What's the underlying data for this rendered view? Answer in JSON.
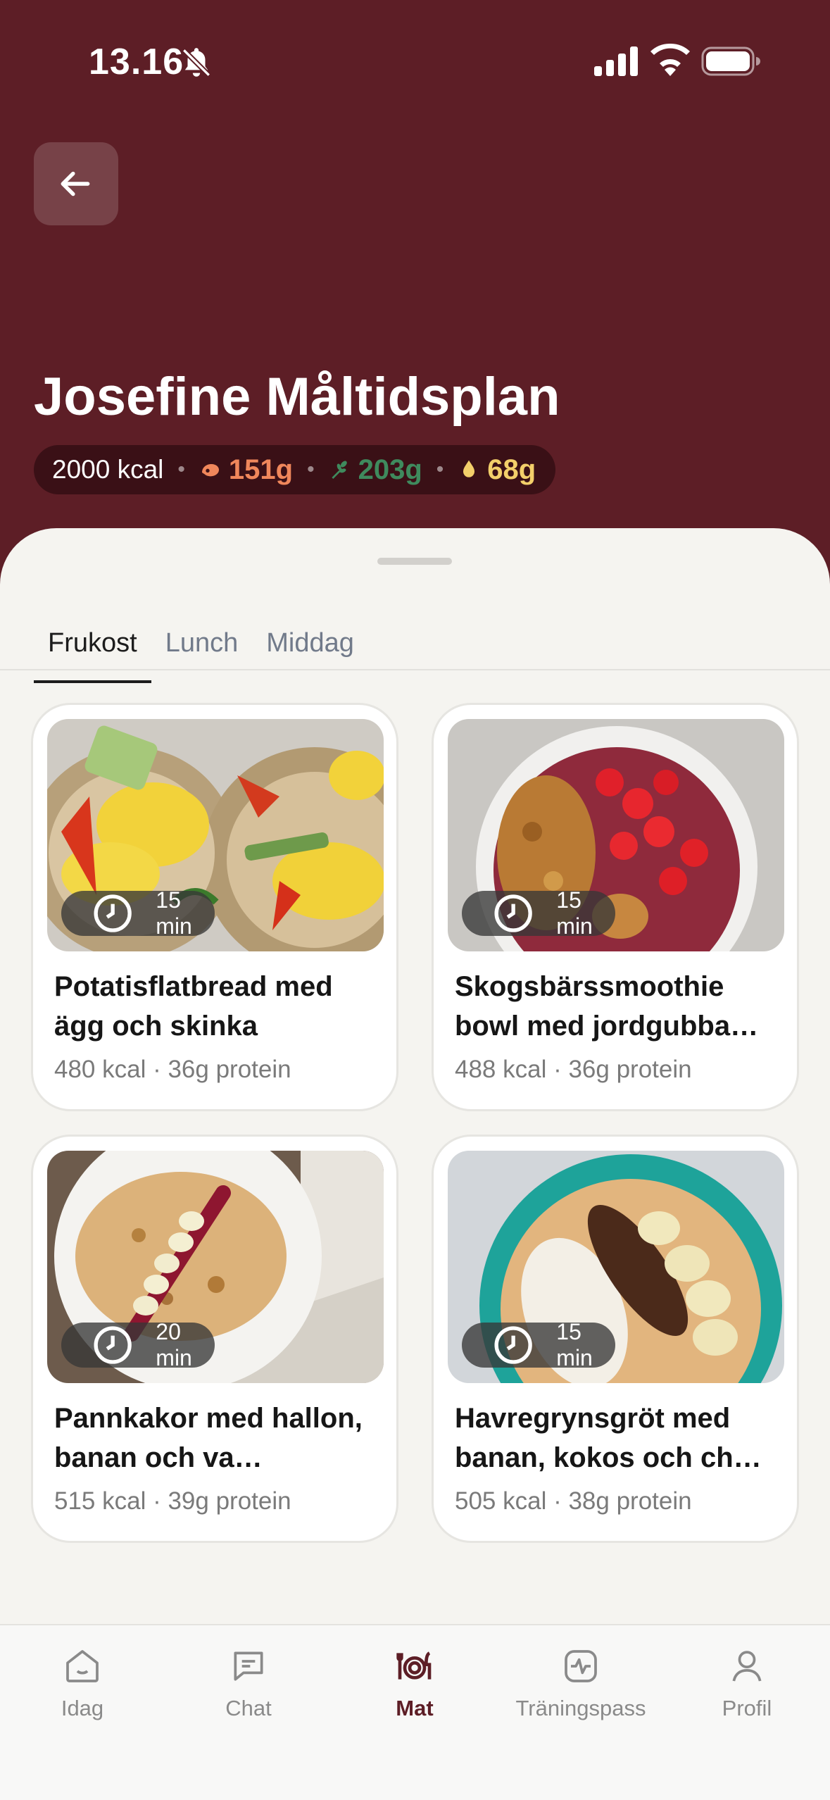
{
  "status_bar": {
    "time": "13.16"
  },
  "header": {
    "title": "Josefine Måltidsplan",
    "macros": {
      "kcal": "2000 kcal",
      "protein": "151g",
      "carbs": "203g",
      "fat": "68g",
      "protein_color": "#f0875b",
      "carbs_color": "#3f8a5d",
      "fat_color": "#f3cf6a"
    }
  },
  "tabs": [
    {
      "label": "Frukost",
      "active": true
    },
    {
      "label": "Lunch",
      "active": false
    },
    {
      "label": "Middag",
      "active": false
    }
  ],
  "meals": [
    {
      "time": "15 min",
      "title": "Potatisflatbread med ägg och skinka",
      "meta": "480 kcal · 36g protein"
    },
    {
      "time": "15 min",
      "title": "Skogsbärssmoothie bowl med jordgubba…",
      "meta": "488 kcal · 36g protein"
    },
    {
      "time": "20 min",
      "title": "Pannkakor med hallon, banan och va…",
      "meta": "515 kcal · 39g protein"
    },
    {
      "time": "15 min",
      "title": "Havregrynsgröt med banan, kokos och ch…",
      "meta": "505 kcal · 38g protein"
    }
  ],
  "nav": [
    {
      "label": "Idag",
      "icon": "home-icon"
    },
    {
      "label": "Chat",
      "icon": "chat-icon"
    },
    {
      "label": "Mat",
      "icon": "plate-cutlery-icon",
      "active": true
    },
    {
      "label": "Träningspass",
      "icon": "activity-icon"
    },
    {
      "label": "Profil",
      "icon": "person-icon"
    }
  ],
  "colors": {
    "brand": "#5d1e26",
    "sheet": "#f5f4f0"
  }
}
